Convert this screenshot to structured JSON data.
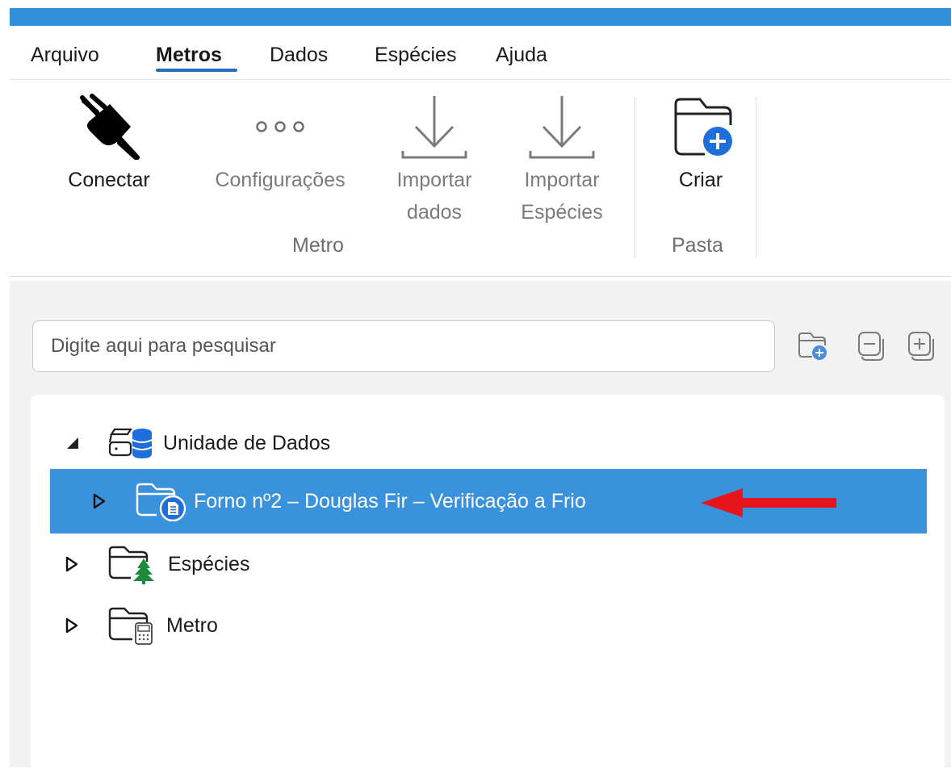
{
  "menu": {
    "items": [
      "Arquivo",
      "Metros",
      "Dados",
      "Espécies",
      "Ajuda"
    ],
    "active": "Metros"
  },
  "ribbon": {
    "connect_label": "Conectar",
    "settings_label": "Configurações",
    "import_data_label_1": "Importar",
    "import_data_label_2": "dados",
    "import_species_label_1": "Importar",
    "import_species_label_2": "Espécies",
    "create_label": "Criar",
    "group_meter_label": "Metro",
    "group_folder_label": "Pasta"
  },
  "search": {
    "placeholder": "Digite aqui para pesquisar"
  },
  "tree": {
    "root_label": "Unidade de Dados",
    "items": [
      {
        "label": "Forno nº2 – Douglas Fir – Verificação a Frio",
        "selected": true,
        "icon": "folder-document-icon"
      },
      {
        "label": "Espécies",
        "icon": "folder-tree-icon"
      },
      {
        "label": "Metro",
        "icon": "folder-meter-icon"
      }
    ]
  },
  "colors": {
    "accent": "#3390dc",
    "selection": "#3a92dc",
    "annotation_arrow": "#e8141b",
    "icon_blue": "#1e6fd9"
  }
}
